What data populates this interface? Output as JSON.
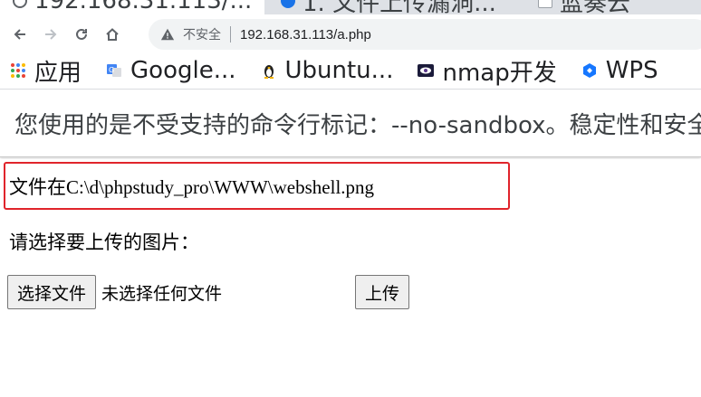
{
  "tabs": [
    {
      "title": "192.168.31.113/...",
      "icon": "globe-icon"
    },
    {
      "title": "1. 文件上传漏洞...",
      "icon": "edge-icon"
    },
    {
      "title": "蓝奏云",
      "icon": "page-icon"
    }
  ],
  "toolbar": {
    "security_label": "不安全",
    "url": "192.168.31.113/a.php"
  },
  "bookmarks": [
    {
      "label": "应用",
      "icon": "apps-grid-icon"
    },
    {
      "label": "Google...",
      "icon": "google-translate-icon"
    },
    {
      "label": "Ubuntu...",
      "icon": "tux-icon"
    },
    {
      "label": "nmap开发",
      "icon": "eye-icon"
    },
    {
      "label": "WPS",
      "icon": "wps-icon"
    }
  ],
  "infobar": {
    "message": "您使用的是不受支持的命令行标记：--no-sandbox。稳定性和安全性会有所下降。"
  },
  "page": {
    "file_location": "文件在C:\\d\\phpstudy_pro\\WWW\\webshell.png",
    "prompt": "请选择要上传的图片：",
    "choose_file_label": "选择文件",
    "no_file_label": "未选择任何文件",
    "upload_label": "上传"
  },
  "colors": {
    "highlight_border": "#e0242b",
    "tabstrip_bg": "#dee1e6",
    "omnibox_bg": "#f1f3f4"
  }
}
